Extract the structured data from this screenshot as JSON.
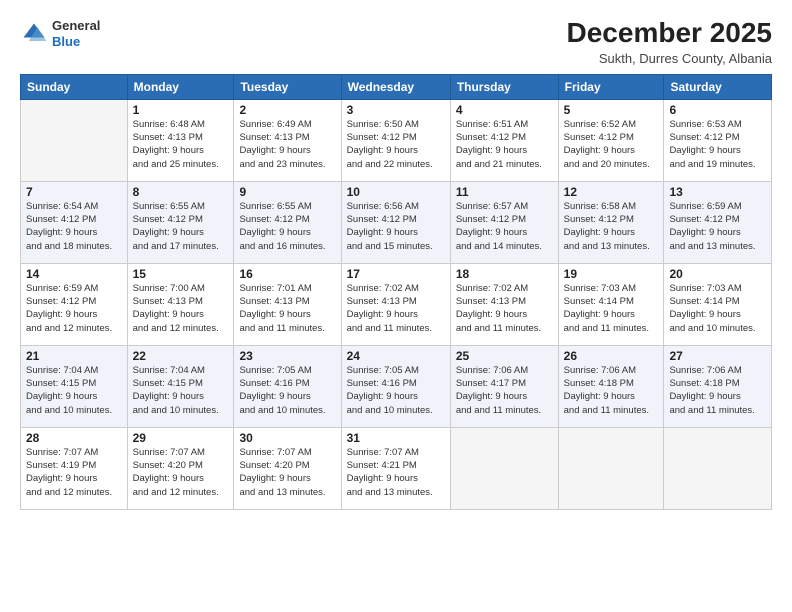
{
  "logo": {
    "general": "General",
    "blue": "Blue"
  },
  "title": "December 2025",
  "subtitle": "Sukth, Durres County, Albania",
  "header_days": [
    "Sunday",
    "Monday",
    "Tuesday",
    "Wednesday",
    "Thursday",
    "Friday",
    "Saturday"
  ],
  "weeks": [
    [
      {
        "day": "",
        "sunrise": "",
        "sunset": "",
        "daylight": "",
        "empty": true
      },
      {
        "day": "1",
        "sunrise": "Sunrise: 6:48 AM",
        "sunset": "Sunset: 4:13 PM",
        "daylight": "Daylight: 9 hours and 25 minutes."
      },
      {
        "day": "2",
        "sunrise": "Sunrise: 6:49 AM",
        "sunset": "Sunset: 4:13 PM",
        "daylight": "Daylight: 9 hours and 23 minutes."
      },
      {
        "day": "3",
        "sunrise": "Sunrise: 6:50 AM",
        "sunset": "Sunset: 4:12 PM",
        "daylight": "Daylight: 9 hours and 22 minutes."
      },
      {
        "day": "4",
        "sunrise": "Sunrise: 6:51 AM",
        "sunset": "Sunset: 4:12 PM",
        "daylight": "Daylight: 9 hours and 21 minutes."
      },
      {
        "day": "5",
        "sunrise": "Sunrise: 6:52 AM",
        "sunset": "Sunset: 4:12 PM",
        "daylight": "Daylight: 9 hours and 20 minutes."
      },
      {
        "day": "6",
        "sunrise": "Sunrise: 6:53 AM",
        "sunset": "Sunset: 4:12 PM",
        "daylight": "Daylight: 9 hours and 19 minutes."
      }
    ],
    [
      {
        "day": "7",
        "sunrise": "Sunrise: 6:54 AM",
        "sunset": "Sunset: 4:12 PM",
        "daylight": "Daylight: 9 hours and 18 minutes."
      },
      {
        "day": "8",
        "sunrise": "Sunrise: 6:55 AM",
        "sunset": "Sunset: 4:12 PM",
        "daylight": "Daylight: 9 hours and 17 minutes."
      },
      {
        "day": "9",
        "sunrise": "Sunrise: 6:55 AM",
        "sunset": "Sunset: 4:12 PM",
        "daylight": "Daylight: 9 hours and 16 minutes."
      },
      {
        "day": "10",
        "sunrise": "Sunrise: 6:56 AM",
        "sunset": "Sunset: 4:12 PM",
        "daylight": "Daylight: 9 hours and 15 minutes."
      },
      {
        "day": "11",
        "sunrise": "Sunrise: 6:57 AM",
        "sunset": "Sunset: 4:12 PM",
        "daylight": "Daylight: 9 hours and 14 minutes."
      },
      {
        "day": "12",
        "sunrise": "Sunrise: 6:58 AM",
        "sunset": "Sunset: 4:12 PM",
        "daylight": "Daylight: 9 hours and 13 minutes."
      },
      {
        "day": "13",
        "sunrise": "Sunrise: 6:59 AM",
        "sunset": "Sunset: 4:12 PM",
        "daylight": "Daylight: 9 hours and 13 minutes."
      }
    ],
    [
      {
        "day": "14",
        "sunrise": "Sunrise: 6:59 AM",
        "sunset": "Sunset: 4:12 PM",
        "daylight": "Daylight: 9 hours and 12 minutes."
      },
      {
        "day": "15",
        "sunrise": "Sunrise: 7:00 AM",
        "sunset": "Sunset: 4:13 PM",
        "daylight": "Daylight: 9 hours and 12 minutes."
      },
      {
        "day": "16",
        "sunrise": "Sunrise: 7:01 AM",
        "sunset": "Sunset: 4:13 PM",
        "daylight": "Daylight: 9 hours and 11 minutes."
      },
      {
        "day": "17",
        "sunrise": "Sunrise: 7:02 AM",
        "sunset": "Sunset: 4:13 PM",
        "daylight": "Daylight: 9 hours and 11 minutes."
      },
      {
        "day": "18",
        "sunrise": "Sunrise: 7:02 AM",
        "sunset": "Sunset: 4:13 PM",
        "daylight": "Daylight: 9 hours and 11 minutes."
      },
      {
        "day": "19",
        "sunrise": "Sunrise: 7:03 AM",
        "sunset": "Sunset: 4:14 PM",
        "daylight": "Daylight: 9 hours and 11 minutes."
      },
      {
        "day": "20",
        "sunrise": "Sunrise: 7:03 AM",
        "sunset": "Sunset: 4:14 PM",
        "daylight": "Daylight: 9 hours and 10 minutes."
      }
    ],
    [
      {
        "day": "21",
        "sunrise": "Sunrise: 7:04 AM",
        "sunset": "Sunset: 4:15 PM",
        "daylight": "Daylight: 9 hours and 10 minutes."
      },
      {
        "day": "22",
        "sunrise": "Sunrise: 7:04 AM",
        "sunset": "Sunset: 4:15 PM",
        "daylight": "Daylight: 9 hours and 10 minutes."
      },
      {
        "day": "23",
        "sunrise": "Sunrise: 7:05 AM",
        "sunset": "Sunset: 4:16 PM",
        "daylight": "Daylight: 9 hours and 10 minutes."
      },
      {
        "day": "24",
        "sunrise": "Sunrise: 7:05 AM",
        "sunset": "Sunset: 4:16 PM",
        "daylight": "Daylight: 9 hours and 10 minutes."
      },
      {
        "day": "25",
        "sunrise": "Sunrise: 7:06 AM",
        "sunset": "Sunset: 4:17 PM",
        "daylight": "Daylight: 9 hours and 11 minutes."
      },
      {
        "day": "26",
        "sunrise": "Sunrise: 7:06 AM",
        "sunset": "Sunset: 4:18 PM",
        "daylight": "Daylight: 9 hours and 11 minutes."
      },
      {
        "day": "27",
        "sunrise": "Sunrise: 7:06 AM",
        "sunset": "Sunset: 4:18 PM",
        "daylight": "Daylight: 9 hours and 11 minutes."
      }
    ],
    [
      {
        "day": "28",
        "sunrise": "Sunrise: 7:07 AM",
        "sunset": "Sunset: 4:19 PM",
        "daylight": "Daylight: 9 hours and 12 minutes."
      },
      {
        "day": "29",
        "sunrise": "Sunrise: 7:07 AM",
        "sunset": "Sunset: 4:20 PM",
        "daylight": "Daylight: 9 hours and 12 minutes."
      },
      {
        "day": "30",
        "sunrise": "Sunrise: 7:07 AM",
        "sunset": "Sunset: 4:20 PM",
        "daylight": "Daylight: 9 hours and 13 minutes."
      },
      {
        "day": "31",
        "sunrise": "Sunrise: 7:07 AM",
        "sunset": "Sunset: 4:21 PM",
        "daylight": "Daylight: 9 hours and 13 minutes."
      },
      {
        "day": "",
        "sunrise": "",
        "sunset": "",
        "daylight": "",
        "empty": true
      },
      {
        "day": "",
        "sunrise": "",
        "sunset": "",
        "daylight": "",
        "empty": true
      },
      {
        "day": "",
        "sunrise": "",
        "sunset": "",
        "daylight": "",
        "empty": true
      }
    ]
  ]
}
